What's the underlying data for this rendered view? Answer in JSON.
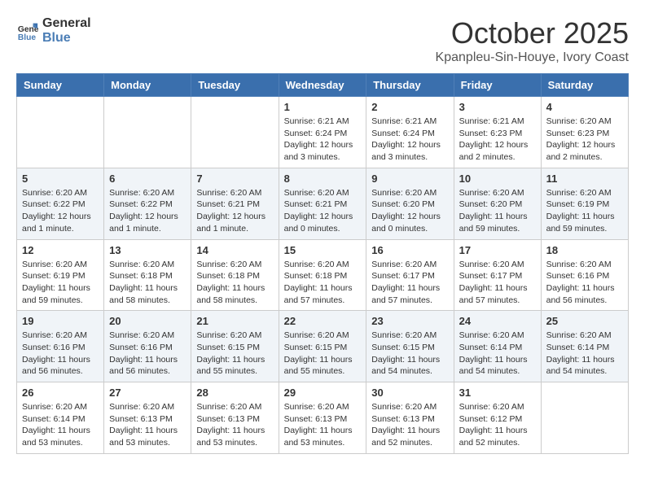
{
  "logo": {
    "general": "General",
    "blue": "Blue"
  },
  "header": {
    "month": "October 2025",
    "location": "Kpanpleu-Sin-Houye, Ivory Coast"
  },
  "days_of_week": [
    "Sunday",
    "Monday",
    "Tuesday",
    "Wednesday",
    "Thursday",
    "Friday",
    "Saturday"
  ],
  "weeks": [
    [
      {
        "day": "",
        "info": ""
      },
      {
        "day": "",
        "info": ""
      },
      {
        "day": "",
        "info": ""
      },
      {
        "day": "1",
        "info": "Sunrise: 6:21 AM\nSunset: 6:24 PM\nDaylight: 12 hours and 3 minutes."
      },
      {
        "day": "2",
        "info": "Sunrise: 6:21 AM\nSunset: 6:24 PM\nDaylight: 12 hours and 3 minutes."
      },
      {
        "day": "3",
        "info": "Sunrise: 6:21 AM\nSunset: 6:23 PM\nDaylight: 12 hours and 2 minutes."
      },
      {
        "day": "4",
        "info": "Sunrise: 6:20 AM\nSunset: 6:23 PM\nDaylight: 12 hours and 2 minutes."
      }
    ],
    [
      {
        "day": "5",
        "info": "Sunrise: 6:20 AM\nSunset: 6:22 PM\nDaylight: 12 hours and 1 minute."
      },
      {
        "day": "6",
        "info": "Sunrise: 6:20 AM\nSunset: 6:22 PM\nDaylight: 12 hours and 1 minute."
      },
      {
        "day": "7",
        "info": "Sunrise: 6:20 AM\nSunset: 6:21 PM\nDaylight: 12 hours and 1 minute."
      },
      {
        "day": "8",
        "info": "Sunrise: 6:20 AM\nSunset: 6:21 PM\nDaylight: 12 hours and 0 minutes."
      },
      {
        "day": "9",
        "info": "Sunrise: 6:20 AM\nSunset: 6:20 PM\nDaylight: 12 hours and 0 minutes."
      },
      {
        "day": "10",
        "info": "Sunrise: 6:20 AM\nSunset: 6:20 PM\nDaylight: 11 hours and 59 minutes."
      },
      {
        "day": "11",
        "info": "Sunrise: 6:20 AM\nSunset: 6:19 PM\nDaylight: 11 hours and 59 minutes."
      }
    ],
    [
      {
        "day": "12",
        "info": "Sunrise: 6:20 AM\nSunset: 6:19 PM\nDaylight: 11 hours and 59 minutes."
      },
      {
        "day": "13",
        "info": "Sunrise: 6:20 AM\nSunset: 6:18 PM\nDaylight: 11 hours and 58 minutes."
      },
      {
        "day": "14",
        "info": "Sunrise: 6:20 AM\nSunset: 6:18 PM\nDaylight: 11 hours and 58 minutes."
      },
      {
        "day": "15",
        "info": "Sunrise: 6:20 AM\nSunset: 6:18 PM\nDaylight: 11 hours and 57 minutes."
      },
      {
        "day": "16",
        "info": "Sunrise: 6:20 AM\nSunset: 6:17 PM\nDaylight: 11 hours and 57 minutes."
      },
      {
        "day": "17",
        "info": "Sunrise: 6:20 AM\nSunset: 6:17 PM\nDaylight: 11 hours and 57 minutes."
      },
      {
        "day": "18",
        "info": "Sunrise: 6:20 AM\nSunset: 6:16 PM\nDaylight: 11 hours and 56 minutes."
      }
    ],
    [
      {
        "day": "19",
        "info": "Sunrise: 6:20 AM\nSunset: 6:16 PM\nDaylight: 11 hours and 56 minutes."
      },
      {
        "day": "20",
        "info": "Sunrise: 6:20 AM\nSunset: 6:16 PM\nDaylight: 11 hours and 56 minutes."
      },
      {
        "day": "21",
        "info": "Sunrise: 6:20 AM\nSunset: 6:15 PM\nDaylight: 11 hours and 55 minutes."
      },
      {
        "day": "22",
        "info": "Sunrise: 6:20 AM\nSunset: 6:15 PM\nDaylight: 11 hours and 55 minutes."
      },
      {
        "day": "23",
        "info": "Sunrise: 6:20 AM\nSunset: 6:15 PM\nDaylight: 11 hours and 54 minutes."
      },
      {
        "day": "24",
        "info": "Sunrise: 6:20 AM\nSunset: 6:14 PM\nDaylight: 11 hours and 54 minutes."
      },
      {
        "day": "25",
        "info": "Sunrise: 6:20 AM\nSunset: 6:14 PM\nDaylight: 11 hours and 54 minutes."
      }
    ],
    [
      {
        "day": "26",
        "info": "Sunrise: 6:20 AM\nSunset: 6:14 PM\nDaylight: 11 hours and 53 minutes."
      },
      {
        "day": "27",
        "info": "Sunrise: 6:20 AM\nSunset: 6:13 PM\nDaylight: 11 hours and 53 minutes."
      },
      {
        "day": "28",
        "info": "Sunrise: 6:20 AM\nSunset: 6:13 PM\nDaylight: 11 hours and 53 minutes."
      },
      {
        "day": "29",
        "info": "Sunrise: 6:20 AM\nSunset: 6:13 PM\nDaylight: 11 hours and 53 minutes."
      },
      {
        "day": "30",
        "info": "Sunrise: 6:20 AM\nSunset: 6:13 PM\nDaylight: 11 hours and 52 minutes."
      },
      {
        "day": "31",
        "info": "Sunrise: 6:20 AM\nSunset: 6:12 PM\nDaylight: 11 hours and 52 minutes."
      },
      {
        "day": "",
        "info": ""
      }
    ]
  ]
}
